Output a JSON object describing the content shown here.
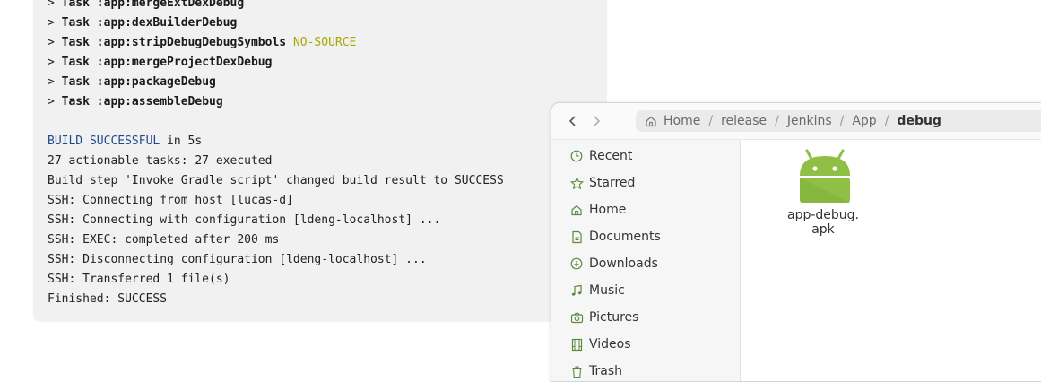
{
  "console": {
    "lines": [
      {
        "prefix": "> ",
        "task": "Task :app:mergeExtDexDebug"
      },
      {
        "prefix": "> ",
        "task": "Task :app:dexBuilderDebug"
      },
      {
        "prefix": "> ",
        "task": "Task :app:stripDebugDebugSymbols",
        "suffix": "NO-SOURCE"
      },
      {
        "prefix": "> ",
        "task": "Task :app:mergeProjectDexDebug"
      },
      {
        "prefix": "> ",
        "task": "Task :app:packageDebug"
      },
      {
        "prefix": "> ",
        "task": "Task :app:assembleDebug"
      }
    ],
    "build_status": "BUILD SUCCESSFUL",
    "build_time": " in 5s",
    "tail": [
      "27 actionable tasks: 27 executed",
      "Build step 'Invoke Gradle script' changed build result to SUCCESS",
      "SSH: Connecting from host [lucas-d]",
      "SSH: Connecting with configuration [ldeng-localhost] ...",
      "SSH: EXEC: completed after 200 ms",
      "SSH: Disconnecting configuration [ldeng-localhost] ...",
      "SSH: Transferred 1 file(s)",
      "Finished: SUCCESS"
    ],
    "colors": {
      "task_suffix": "#a8a800",
      "build_status": "#1e4a8a"
    }
  },
  "file_manager": {
    "nav": {
      "back_icon": "chevron-left-icon",
      "forward_icon": "chevron-right-icon"
    },
    "path": {
      "home_icon": "home-icon",
      "segments": [
        "Home",
        "release",
        "Jenkins",
        "App"
      ],
      "separator": "/",
      "current": "debug"
    },
    "sidebar": [
      {
        "label": "Recent",
        "icon": "clock-icon"
      },
      {
        "label": "Starred",
        "icon": "star-icon"
      },
      {
        "label": "Home",
        "icon": "home-icon"
      },
      {
        "label": "Documents",
        "icon": "document-icon"
      },
      {
        "label": "Downloads",
        "icon": "download-icon"
      },
      {
        "label": "Music",
        "icon": "music-note-icon"
      },
      {
        "label": "Pictures",
        "icon": "camera-icon"
      },
      {
        "label": "Videos",
        "icon": "film-icon"
      },
      {
        "label": "Trash",
        "icon": "trash-icon"
      }
    ],
    "files": [
      {
        "name": "app-debug.\napk",
        "icon": "android-apk-icon"
      }
    ],
    "colors": {
      "android_green": "#8fc045"
    }
  }
}
